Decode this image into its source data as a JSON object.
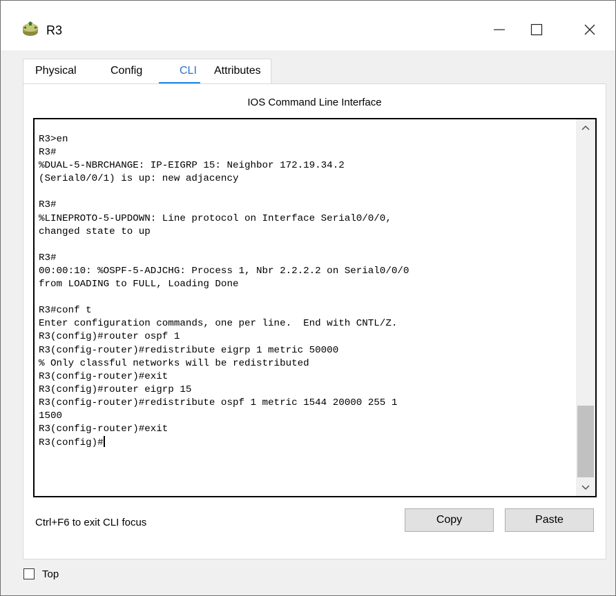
{
  "window": {
    "title": "R3",
    "icon": "router-icon",
    "controls": {
      "minimize": "—",
      "maximize": "☐",
      "close": "✕"
    }
  },
  "tabs": [
    {
      "label": "Physical"
    },
    {
      "label": "Config"
    },
    {
      "label": "CLI",
      "active": true
    },
    {
      "label": "Attributes"
    }
  ],
  "panel": {
    "title": "IOS Command Line Interface"
  },
  "terminal": {
    "lines": [
      "R3>en",
      "R3#",
      "%DUAL-5-NBRCHANGE: IP-EIGRP 15: Neighbor 172.19.34.2",
      "(Serial0/0/1) is up: new adjacency",
      "",
      "R3#",
      "%LINEPROTO-5-UPDOWN: Line protocol on Interface Serial0/0/0,",
      "changed state to up",
      "",
      "R3#",
      "00:00:10: %OSPF-5-ADJCHG: Process 1, Nbr 2.2.2.2 on Serial0/0/0",
      "from LOADING to FULL, Loading Done",
      "",
      "R3#conf t",
      "Enter configuration commands, one per line.  End with CNTL/Z.",
      "R3(config)#router ospf 1",
      "R3(config-router)#redistribute eigrp 1 metric 50000",
      "% Only classful networks will be redistributed",
      "R3(config-router)#exit",
      "R3(config)#router eigrp 15",
      "R3(config-router)#redistribute ospf 1 metric 1544 20000 255 1",
      "1500",
      "R3(config-router)#exit"
    ],
    "prompt": "R3(config)#"
  },
  "footer": {
    "hint": "Ctrl+F6 to exit CLI focus",
    "copy_label": "Copy",
    "paste_label": "Paste"
  },
  "top_checkbox": {
    "label": "Top",
    "checked": false
  }
}
